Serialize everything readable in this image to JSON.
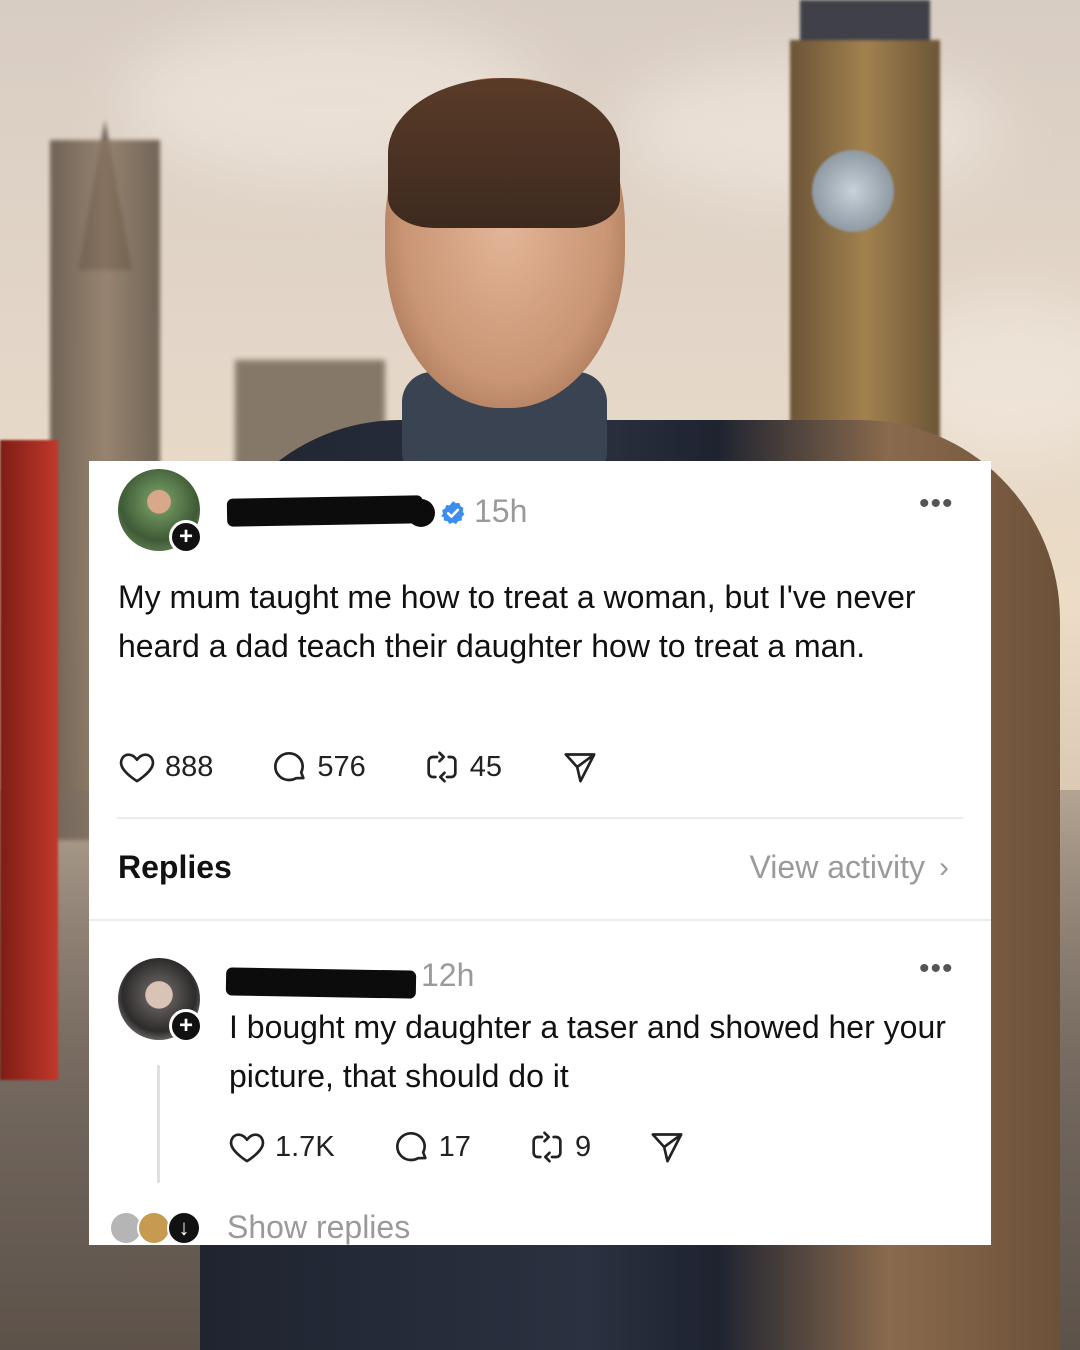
{
  "post": {
    "time": "15h",
    "text": "My mum taught me how to treat a woman, but I've never heard a dad teach their daughter how to treat a man.",
    "likes": "888",
    "comments": "576",
    "reposts": "45"
  },
  "replies_section": {
    "label": "Replies",
    "view_activity": "View activity",
    "chevron": "›"
  },
  "reply": {
    "time": "12h",
    "text": "I bought my daughter a taser and showed her your picture, that should do it",
    "likes": "1.7K",
    "comments": "17",
    "reposts": "9"
  },
  "show_replies": "Show replies",
  "icons": {
    "more": "•••",
    "plus": "+",
    "arrow_down": "↓"
  },
  "colors": {
    "verified": "#3b8ef0",
    "muted_text": "#9a9a9a"
  }
}
